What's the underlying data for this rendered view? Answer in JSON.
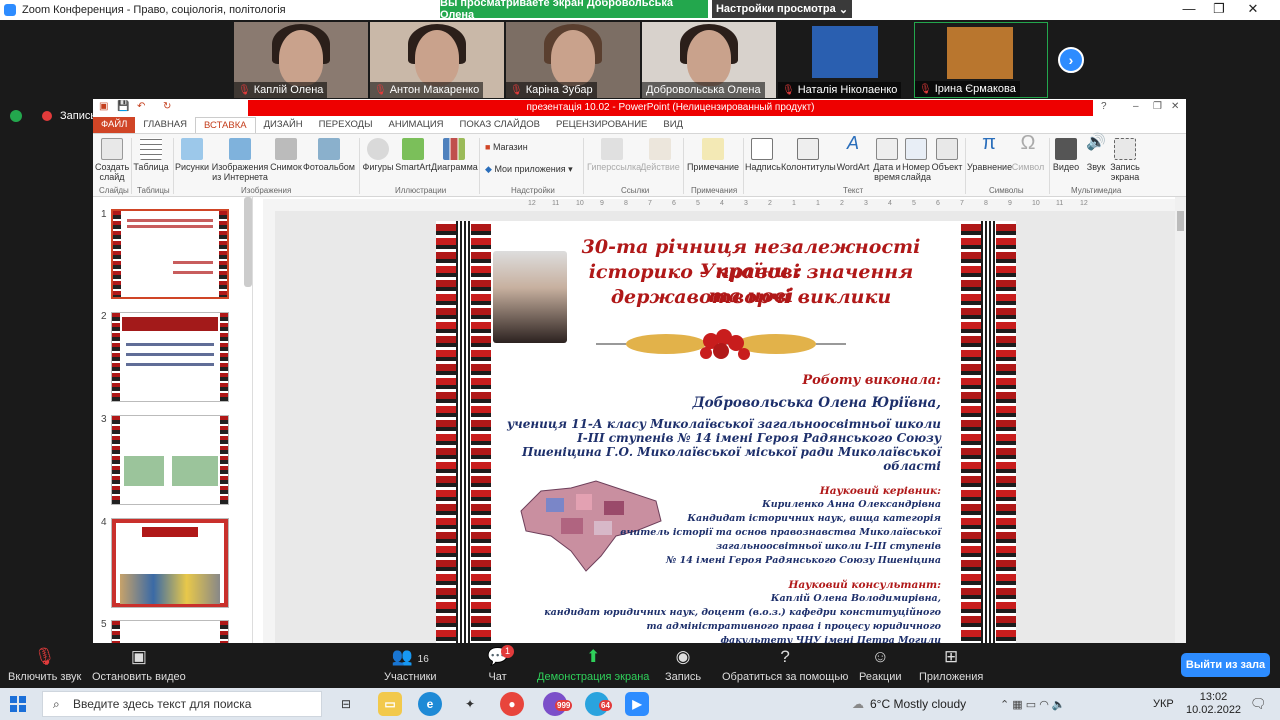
{
  "zoom": {
    "title": "Zoom Конференция - Право, соціологія, політологія",
    "share_banner": "Вы просматриваете экран Добровольська Олена",
    "view_options": "Настройки просмотра",
    "security_label": "Запись",
    "participants": [
      "Каплій Олена",
      "Антон Макаренко",
      "Каріна Зубар",
      "Добровольська Олена",
      "Наталія Ніколаенко",
      "Ірина Єрмакова"
    ]
  },
  "ppt": {
    "title": "презентація 10.02 - PowerPoint (Нелицензированный продукт)",
    "tabs": [
      "ФАЙЛ",
      "ГЛАВНАЯ",
      "ВСТАВКА",
      "ДИЗАЙН",
      "ПЕРЕХОДЫ",
      "АНИМАЦИЯ",
      "ПОКАЗ СЛАЙДОВ",
      "РЕЦЕНЗИРОВАНИЕ",
      "ВИД"
    ],
    "ribbon": {
      "create_slide": "Создать слайд",
      "table": "Таблица",
      "pictures": "Рисунки",
      "online_pictures": "Изображения из Интернета",
      "screenshot": "Снимок",
      "photo_album": "Фотоальбом",
      "shapes": "Фигуры",
      "smartart": "SmartArt",
      "chart": "Диаграмма",
      "store": "Магазин",
      "my_apps": "Мои приложения",
      "hyperlink": "Гиперссылка",
      "action": "Действие",
      "comment": "Примечание",
      "textbox": "Надпись",
      "header_footer": "Колонтитулы",
      "wordart": "WordArt",
      "datetime": "Дата и время",
      "slide_number": "Номер слайда",
      "object": "Объект",
      "equation": "Уравнение",
      "symbol": "Символ",
      "video": "Видео",
      "audio": "Звук",
      "screen_record": "Запись экрана",
      "groups": [
        "Слайды",
        "Таблицы",
        "Изображения",
        "Иллюстрации",
        "Надстройки",
        "Ссылки",
        "Примечания",
        "Текст",
        "Символы",
        "Мультимедиа"
      ]
    },
    "thumb_numbers": [
      "1",
      "2",
      "3",
      "4",
      "5"
    ],
    "ruler_numbers": [
      "12",
      "11",
      "10",
      "9",
      "8",
      "7",
      "6",
      "5",
      "4",
      "3",
      "2",
      "1",
      "1",
      "2",
      "3",
      "4",
      "5",
      "6",
      "7",
      "8",
      "9",
      "10",
      "11",
      "12"
    ]
  },
  "slide": {
    "title_lines": [
      "30-та річниця незалежності України :",
      "історико – правові значення та нові",
      "державотворчі виклики"
    ],
    "author_label": "Роботу виконала:",
    "author_name": "Добровольська Олена Юріївна,",
    "author_info": [
      "учениця 11-А класу Миколаївської загальноосвітньої школи",
      "І-ІІІ ступенів № 14 імені Героя Радянського Союзу",
      "Пшеніцина Г.О. Миколаївської міської ради Миколаївської",
      "області"
    ],
    "supervisor_label": "Науковий керівник:",
    "supervisor": [
      "Кириленко Анна Олександрівна",
      "Кандидат історичних наук, вища категорія",
      "вчитель історії та основ правознавства Миколаївської",
      "загальноосвітньої школи І-ІІІ ступенів",
      "№ 14 імені Героя Радянського Союзу Пшеніцина"
    ],
    "consultant_label": "Науковий консультант:",
    "consultant": [
      "Каплій Олена Володимирівна,",
      "кандидат юридичних наук, доцент (в.о.з.) кафедри конституційного",
      "та адміністративного права і процесу юридичного",
      "факультету ЧНУ імені Петра Могили"
    ]
  },
  "toolbar": {
    "mute": "Включить звук",
    "video": "Остановить видео",
    "participants": "Участники",
    "participants_count": "16",
    "chat": "Чат",
    "chat_badge": "1",
    "share": "Демонстрация экрана",
    "record": "Запись",
    "help": "Обратиться за помощью",
    "reactions": "Реакции",
    "apps": "Приложения",
    "leave": "Выйти из зала"
  },
  "taskbar": {
    "search_placeholder": "Введите здесь текст для поиска",
    "weather": "6°C  Mostly cloudy",
    "lang": "УКР",
    "time": "13:02",
    "date": "10.02.2022",
    "badge_viber": "999",
    "badge_telegram": "64"
  },
  "colors": {
    "zoom_blue": "#2d8cff",
    "share_green": "#23a74d",
    "ppt_orange": "#d04526",
    "slide_red": "#b01818",
    "slide_navy": "#1d2f6b"
  }
}
